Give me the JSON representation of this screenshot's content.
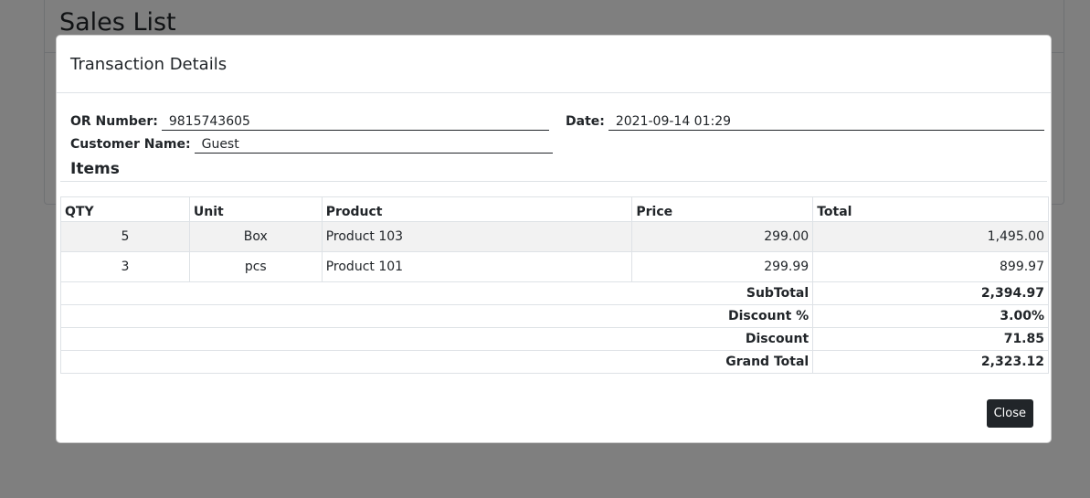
{
  "background": {
    "page_title": "Sales List"
  },
  "modal": {
    "title": "Transaction Details",
    "fields": {
      "or_number": {
        "label": "OR Number:",
        "value": "9815743605"
      },
      "date": {
        "label": "Date:",
        "value": "2021-09-14 01:29"
      },
      "customer_name": {
        "label": "Customer Name:",
        "value": "Guest"
      }
    },
    "items_title": "Items",
    "table": {
      "headers": [
        "QTY",
        "Unit",
        "Product",
        "Price",
        "Total"
      ],
      "rows": [
        {
          "qty": "5",
          "unit": "Box",
          "product": "Product 103",
          "price": "299.00",
          "total": "1,495.00"
        },
        {
          "qty": "3",
          "unit": "pcs",
          "product": "Product 101",
          "price": "299.99",
          "total": "899.97"
        }
      ],
      "summary": [
        {
          "label": "SubTotal",
          "value": "2,394.97"
        },
        {
          "label": "Discount %",
          "value": "3.00%"
        },
        {
          "label": "Discount",
          "value": "71.85"
        },
        {
          "label": "Grand Total",
          "value": "2,323.12"
        }
      ]
    },
    "close_label": "Close"
  },
  "colors": {
    "backdrop": "#808080",
    "button": "#212529"
  }
}
